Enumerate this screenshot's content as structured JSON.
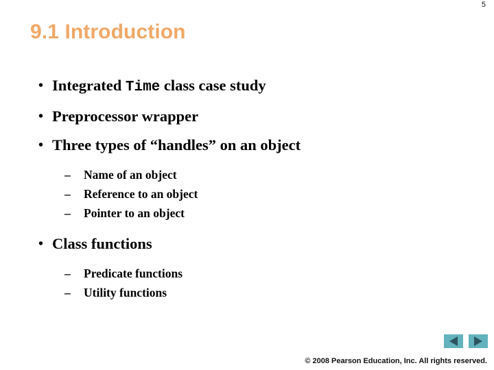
{
  "slide": {
    "page_number": "5",
    "title": "9.1  Introduction",
    "background_color": "#FFFFFF",
    "title_color": "#F0A868"
  },
  "content": {
    "bullets": [
      {
        "marker": "•",
        "parts": [
          {
            "text": "Integrated ",
            "style": "normal"
          },
          {
            "text": "Time",
            "style": "code"
          },
          {
            "text": " class case study",
            "style": "normal"
          }
        ],
        "sub_items": []
      },
      {
        "marker": "•",
        "parts": [
          {
            "text": "Preprocessor wrapper",
            "style": "normal"
          }
        ],
        "sub_items": []
      },
      {
        "marker": "•",
        "parts": [
          {
            "text": "Three types of “handles” on an object",
            "style": "normal"
          }
        ],
        "sub_items": [
          {
            "marker": "–",
            "text": "Name of an object"
          },
          {
            "marker": "–",
            "text": "Reference to an object"
          },
          {
            "marker": "–",
            "text": "Pointer to an object"
          }
        ]
      },
      {
        "marker": "•",
        "parts": [
          {
            "text": "Class functions",
            "style": "normal"
          }
        ],
        "sub_items": [
          {
            "marker": "–",
            "text": "Predicate functions"
          },
          {
            "marker": "–",
            "text": "Utility functions"
          }
        ]
      }
    ]
  },
  "footer": {
    "copyright": "© 2008 Pearson Education, Inc.  All rights reserved.",
    "nav": {
      "previous_label": "previous-slide",
      "next_label": "next-slide",
      "button_color": "#62B3BD",
      "arrow_color": "#2D5560"
    }
  }
}
